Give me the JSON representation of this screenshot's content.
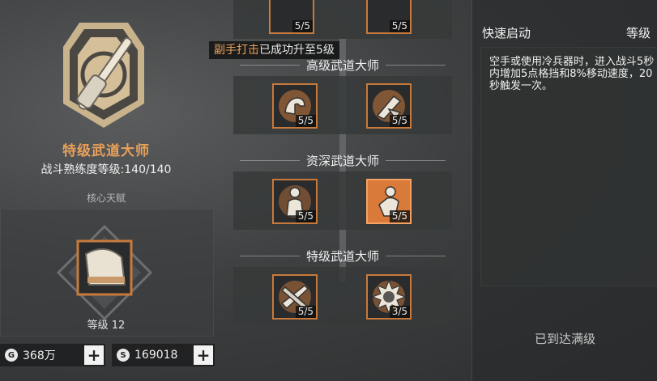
{
  "rank": {
    "title": "特级武道大师",
    "mastery_label": "战斗熟练度等级:140/140"
  },
  "core": {
    "label": "核心天赋",
    "level_label": "等级 12"
  },
  "currency": [
    {
      "icon": "gear-coin-icon",
      "symbol": "G",
      "value": "368万"
    },
    {
      "icon": "silver-coin-icon",
      "symbol": "S",
      "value": "169018"
    }
  ],
  "tooltip": {
    "highlight": "副手打击",
    "rest": "已成功升至5级"
  },
  "tiers": [
    {
      "title": "",
      "skills": [
        {
          "icon": "skill-icon",
          "level": "5/5"
        },
        {
          "icon": "skill-icon",
          "level": "5/5"
        }
      ]
    },
    {
      "title": "高级武道大师",
      "skills": [
        {
          "icon": "flex-arm-icon",
          "level": "5/5"
        },
        {
          "icon": "blade-strike-icon",
          "level": "5/5"
        }
      ]
    },
    {
      "title": "资深武道大师",
      "skills": [
        {
          "icon": "fighter-icon",
          "level": "5/5"
        },
        {
          "icon": "fighter-strike-icon",
          "level": "5/5"
        }
      ]
    },
    {
      "title": "特级武道大师",
      "skills": [
        {
          "icon": "crossed-blades-icon",
          "level": "5/5"
        },
        {
          "icon": "spiked-fist-icon",
          "level": "3/5"
        }
      ]
    }
  ],
  "detail": {
    "name": "快速启动",
    "level_label": "等级",
    "description": "空手或使用冷兵器时，进入战斗5秒内增加5点格挡和8%移动速度，20秒触发一次。",
    "status": "已到达满级"
  },
  "colors": {
    "accent": "#e9a15a",
    "skill_border": "#c77a3c",
    "skill_active": "#d9793a"
  }
}
